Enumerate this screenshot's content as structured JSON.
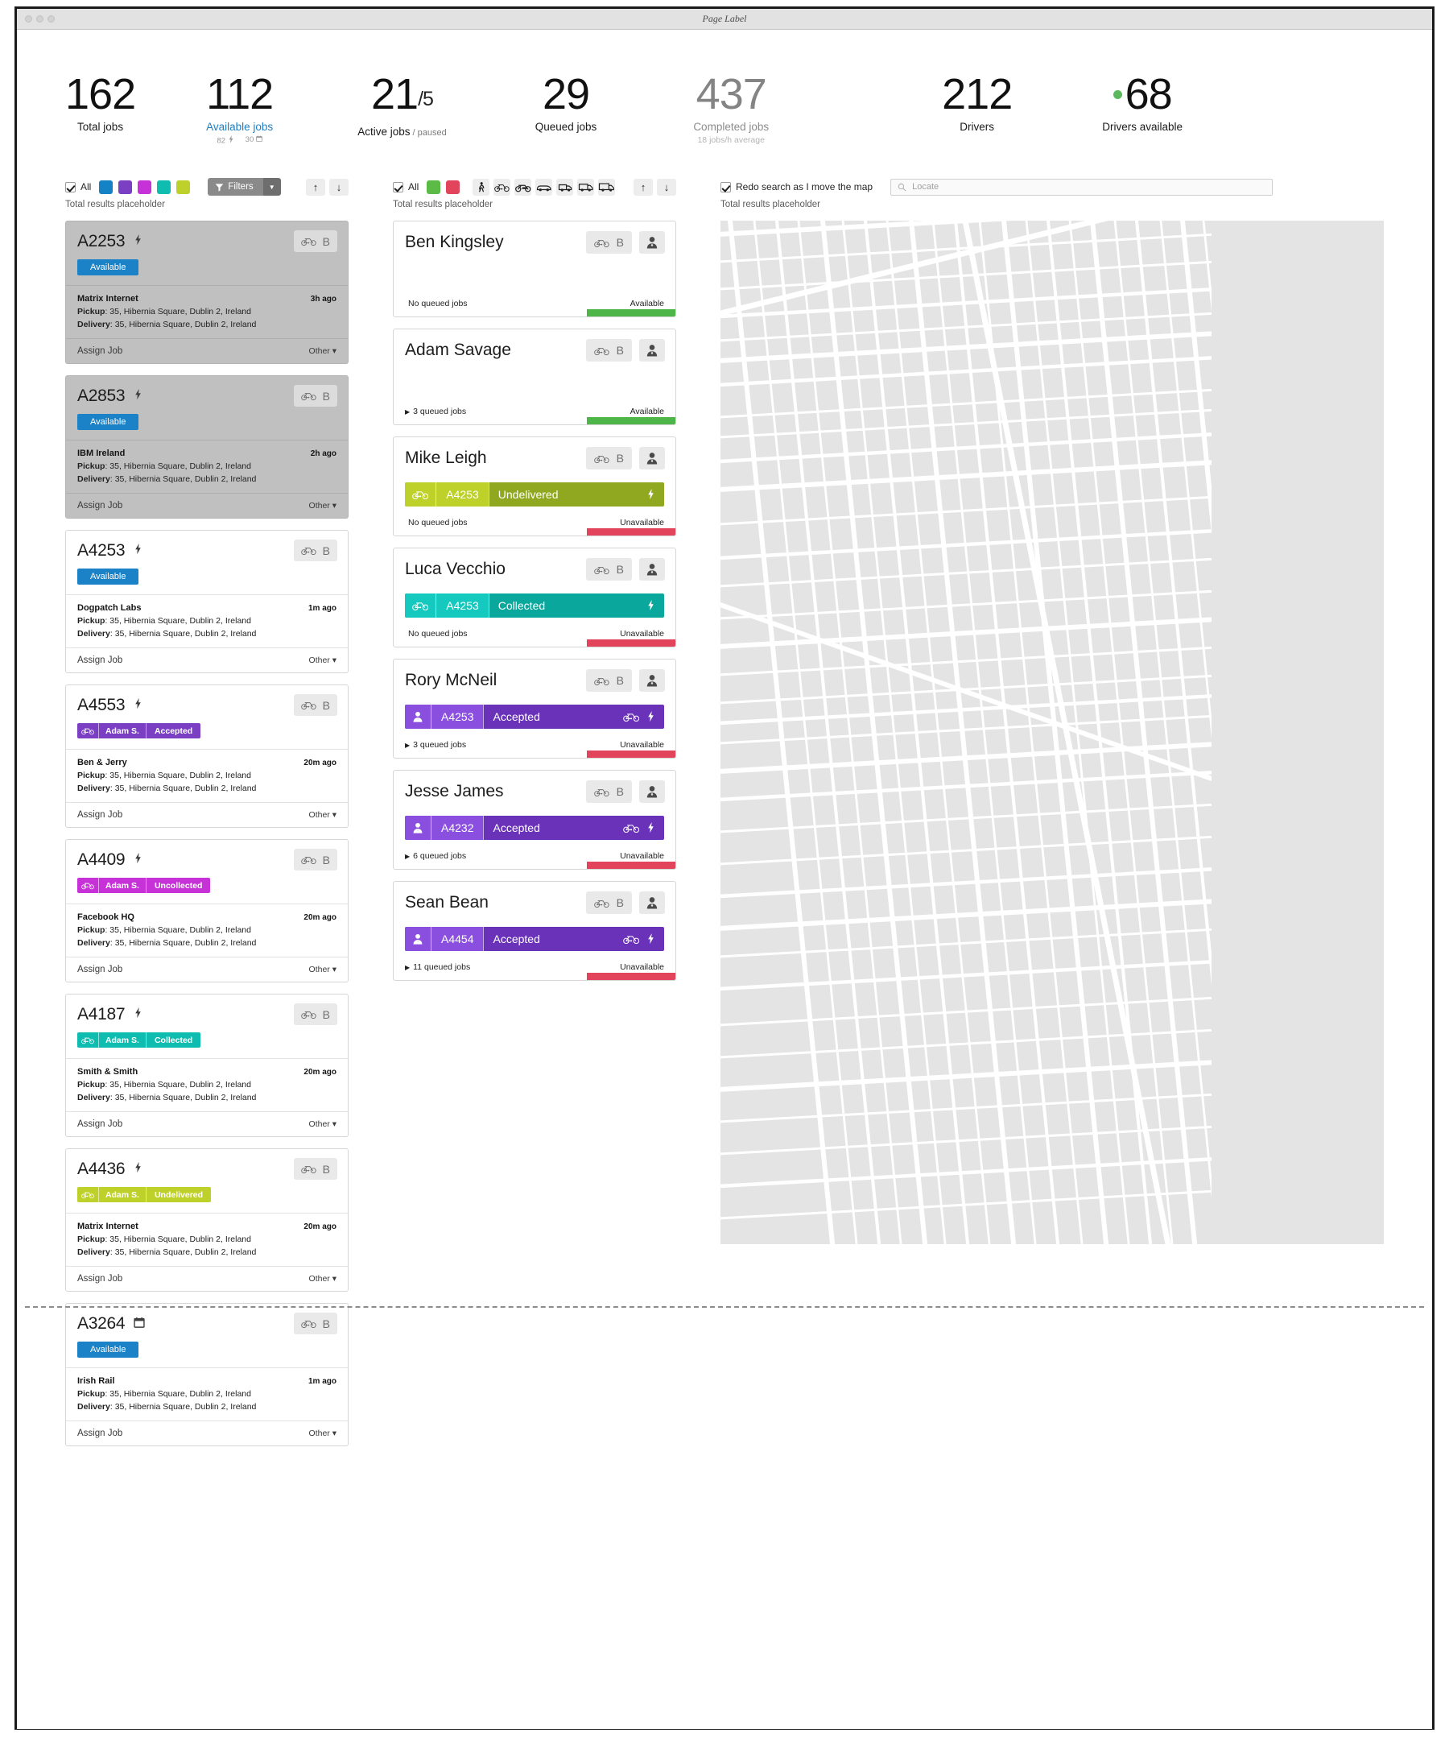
{
  "window": {
    "title": "Page Label"
  },
  "stats": [
    {
      "id": "total-jobs",
      "value": "162",
      "label": "Total jobs",
      "style": "dark"
    },
    {
      "id": "available-jobs",
      "value": "112",
      "label": "Available jobs",
      "style": "blue",
      "meta": [
        {
          "text": "82",
          "icon": "bolt-icon"
        },
        {
          "text": "30",
          "icon": "calendar-icon"
        }
      ]
    },
    {
      "id": "active-jobs",
      "value": "21",
      "suffix": "/5",
      "label": "Active jobs",
      "sublabel": "/ paused",
      "style": "dark"
    },
    {
      "id": "queued-jobs",
      "value": "29",
      "label": "Queued jobs",
      "style": "dark"
    },
    {
      "id": "completed-jobs",
      "value": "437",
      "label": "Completed jobs",
      "meta2": "18 jobs/h average",
      "style": "grey"
    },
    {
      "id": "drivers",
      "value": "212",
      "label": "Drivers",
      "style": "dark"
    },
    {
      "id": "drivers-available",
      "value": "68",
      "label": "Drivers available",
      "style": "dark",
      "dot": "#5cb85c"
    }
  ],
  "jobs_panel": {
    "all_label": "All",
    "swatches": [
      "#1383c6",
      "#7b3fc4",
      "#c731d8",
      "#0fbdb0",
      "#bed12a"
    ],
    "filters_label": "Filters",
    "sort_up": "↑",
    "sort_down": "↓",
    "results": "Total results placeholder",
    "assign_label": "Assign Job",
    "other_label": "Other",
    "cards": [
      {
        "job_id": "A2253",
        "marker": "bolt-icon",
        "selected": true,
        "vehicle": "bicycle-icon",
        "vehicle_letter": "B",
        "pill": {
          "text": "Available",
          "color": "#1b82c8"
        },
        "client": "Matrix Internet",
        "ago": "3h ago",
        "pickup": "35, Hibernia Square, Dublin 2, Ireland",
        "delivery": "35, Hibernia Square, Dublin 2, Ireland"
      },
      {
        "job_id": "A2853",
        "marker": "bolt-icon",
        "selected": true,
        "vehicle": "bicycle-icon",
        "vehicle_letter": "B",
        "pill": {
          "text": "Available",
          "color": "#1b82c8"
        },
        "client": "IBM Ireland",
        "ago": "2h ago",
        "pickup": "35, Hibernia Square, Dublin 2, Ireland",
        "delivery": "35, Hibernia Square, Dublin 2, Ireland"
      },
      {
        "job_id": "A4253",
        "marker": "bolt-icon",
        "selected": false,
        "vehicle": "bicycle-icon",
        "vehicle_letter": "B",
        "pill": {
          "text": "Available",
          "color": "#1b82c8"
        },
        "client": "Dogpatch Labs",
        "ago": "1m ago",
        "pickup": "35, Hibernia Square, Dublin 2, Ireland",
        "delivery": "35, Hibernia Square, Dublin 2, Ireland"
      },
      {
        "job_id": "A4553",
        "marker": "bolt-icon",
        "selected": false,
        "vehicle": "bicycle-icon",
        "vehicle_letter": "B",
        "tri": {
          "driver": "Adam S.",
          "status": "Accepted",
          "color": "#7b3fc4",
          "icon": "bicycle-icon"
        },
        "client": "Ben & Jerry",
        "ago": "20m ago",
        "pickup": "35, Hibernia Square, Dublin 2, Ireland",
        "delivery": "35, Hibernia Square, Dublin 2, Ireland"
      },
      {
        "job_id": "A4409",
        "marker": "bolt-icon",
        "selected": false,
        "vehicle": "bicycle-icon",
        "vehicle_letter": "B",
        "tri": {
          "driver": "Adam S.",
          "status": "Uncollected",
          "color": "#c731d8",
          "icon": "bicycle-icon"
        },
        "client": "Facebook HQ",
        "ago": "20m ago",
        "pickup": "35, Hibernia Square, Dublin 2, Ireland",
        "delivery": "35, Hibernia Square, Dublin 2, Ireland"
      },
      {
        "job_id": "A4187",
        "marker": "bolt-icon",
        "selected": false,
        "vehicle": "bicycle-icon",
        "vehicle_letter": "B",
        "tri": {
          "driver": "Adam S.",
          "status": "Collected",
          "color": "#0fbdb0",
          "icon": "bicycle-icon"
        },
        "client": "Smith & Smith",
        "ago": "20m ago",
        "pickup": "35, Hibernia Square, Dublin 2, Ireland",
        "delivery": "35, Hibernia Square, Dublin 2, Ireland"
      },
      {
        "job_id": "A4436",
        "marker": "bolt-icon",
        "selected": false,
        "vehicle": "bicycle-icon",
        "vehicle_letter": "B",
        "tri": {
          "driver": "Adam S.",
          "status": "Undelivered",
          "color": "#bed12a",
          "icon": "bicycle-icon"
        },
        "client": "Matrix Internet",
        "ago": "20m ago",
        "pickup": "35, Hibernia Square, Dublin 2, Ireland",
        "delivery": "35, Hibernia Square, Dublin 2, Ireland"
      },
      {
        "job_id": "A3264",
        "marker": "calendar-icon",
        "selected": false,
        "vehicle": "bicycle-icon",
        "vehicle_letter": "B",
        "pill": {
          "text": "Available",
          "color": "#1b82c8"
        },
        "client": "Irish Rail",
        "ago": "1m ago",
        "pickup": "35, Hibernia Square, Dublin 2, Ireland",
        "delivery": "35, Hibernia Square, Dublin 2, Ireland"
      }
    ]
  },
  "drivers_panel": {
    "all_label": "All",
    "swatches": [
      "#5cba47",
      "#e2445c"
    ],
    "vehicle_icons": [
      "walk-icon",
      "bicycle-icon",
      "motorbike-icon",
      "car-icon",
      "small-van-icon",
      "van-icon",
      "truck-icon"
    ],
    "sort_up": "↑",
    "sort_down": "↓",
    "results": "Total results placeholder",
    "cards": [
      {
        "name": "Ben Kingsley",
        "vehicle": "bicycle-icon",
        "vehicle_letter": "B",
        "queued": "No queued jobs",
        "availability": "Available",
        "avail_color": "#4eb648",
        "has_job": false
      },
      {
        "name": "Adam Savage",
        "vehicle": "bicycle-icon",
        "vehicle_letter": "B",
        "queued": "3 queued jobs",
        "availability": "Available",
        "avail_color": "#4eb648",
        "has_job": false
      },
      {
        "name": "Mike Leigh",
        "vehicle": "bicycle-icon",
        "vehicle_letter": "B",
        "job": {
          "id": "A4253",
          "status": "Undelivered",
          "color": "#8fa81f",
          "light": "#bed12a",
          "left_icon": "bicycle-icon",
          "right_icons": [
            "bolt-icon"
          ]
        },
        "queued": "No queued jobs",
        "availability": "Unavailable",
        "avail_color": "#e2445c",
        "has_job": true
      },
      {
        "name": "Luca Vecchio",
        "vehicle": "bicycle-icon",
        "vehicle_letter": "B",
        "job": {
          "id": "A4253",
          "status": "Collected",
          "color": "#09a79c",
          "light": "#16c9be",
          "left_icon": "bicycle-icon",
          "right_icons": [
            "bolt-icon"
          ]
        },
        "queued": "No queued jobs",
        "availability": "Unavailable",
        "avail_color": "#e2445c",
        "has_job": true
      },
      {
        "name": "Rory McNeil",
        "vehicle": "bicycle-icon",
        "vehicle_letter": "B",
        "job": {
          "id": "A4253",
          "status": "Accepted",
          "color": "#6a32b8",
          "light": "#8b4fe0",
          "left_icon": "person-icon",
          "right_icons": [
            "bicycle-icon",
            "bolt-icon"
          ]
        },
        "queued": "3 queued jobs",
        "availability": "Unavailable",
        "avail_color": "#e2445c",
        "has_job": true
      },
      {
        "name": "Jesse James",
        "vehicle": "bicycle-icon",
        "vehicle_letter": "B",
        "job": {
          "id": "A4232",
          "status": "Accepted",
          "color": "#6a32b8",
          "light": "#8b4fe0",
          "left_icon": "person-icon",
          "right_icons": [
            "bicycle-icon",
            "bolt-icon"
          ]
        },
        "queued": "6 queued jobs",
        "availability": "Unavailable",
        "avail_color": "#e2445c",
        "has_job": true
      },
      {
        "name": "Sean Bean",
        "vehicle": "bicycle-icon",
        "vehicle_letter": "B",
        "job": {
          "id": "A4454",
          "status": "Accepted",
          "color": "#6a32b8",
          "light": "#8b4fe0",
          "left_icon": "person-icon",
          "right_icons": [
            "bicycle-icon",
            "bolt-icon"
          ]
        },
        "queued": "11 queued jobs",
        "availability": "Unavailable",
        "avail_color": "#e2445c",
        "has_job": true
      }
    ]
  },
  "map_panel": {
    "redo_label": "Redo search as I move the map",
    "search_placeholder": "Locate",
    "results": "Total results placeholder"
  }
}
